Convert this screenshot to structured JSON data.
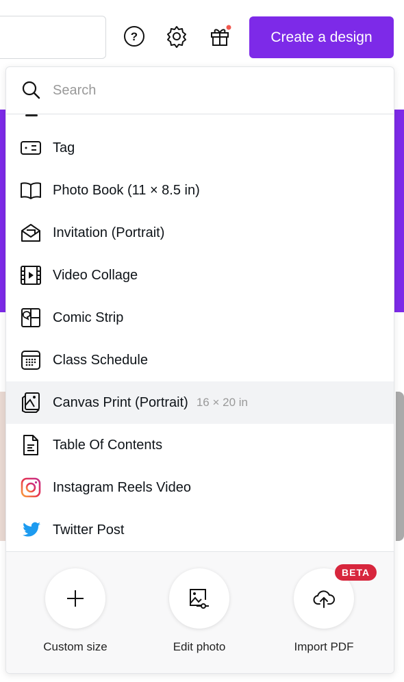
{
  "header": {
    "create_button": "Create a design",
    "icons": [
      "help-icon",
      "settings-icon",
      "gift-icon"
    ],
    "notification_dot_color": "#f0574d",
    "brand_color": "#7d2ae8"
  },
  "dropdown": {
    "search_placeholder": "Search",
    "items": [
      {
        "label": "Tag",
        "icon": "tag-icon"
      },
      {
        "label": "Photo Book (11 × 8.5 in)",
        "icon": "book-icon"
      },
      {
        "label": "Invitation (Portrait)",
        "icon": "envelope-icon"
      },
      {
        "label": "Video Collage",
        "icon": "video-icon"
      },
      {
        "label": "Comic Strip",
        "icon": "comic-icon"
      },
      {
        "label": "Class Schedule",
        "icon": "calendar-icon"
      },
      {
        "label": "Canvas Print (Portrait)",
        "sub": "16 × 20 in",
        "icon": "canvas-print-icon",
        "highlighted": true
      },
      {
        "label": "Table Of Contents",
        "icon": "document-icon"
      },
      {
        "label": "Instagram Reels Video",
        "icon": "instagram-icon"
      },
      {
        "label": "Twitter Post",
        "icon": "twitter-icon"
      }
    ],
    "actions": [
      {
        "label": "Custom size",
        "icon": "plus-icon"
      },
      {
        "label": "Edit photo",
        "icon": "edit-photo-icon"
      },
      {
        "label": "Import PDF",
        "icon": "cloud-upload-icon",
        "badge": "BETA"
      }
    ]
  }
}
